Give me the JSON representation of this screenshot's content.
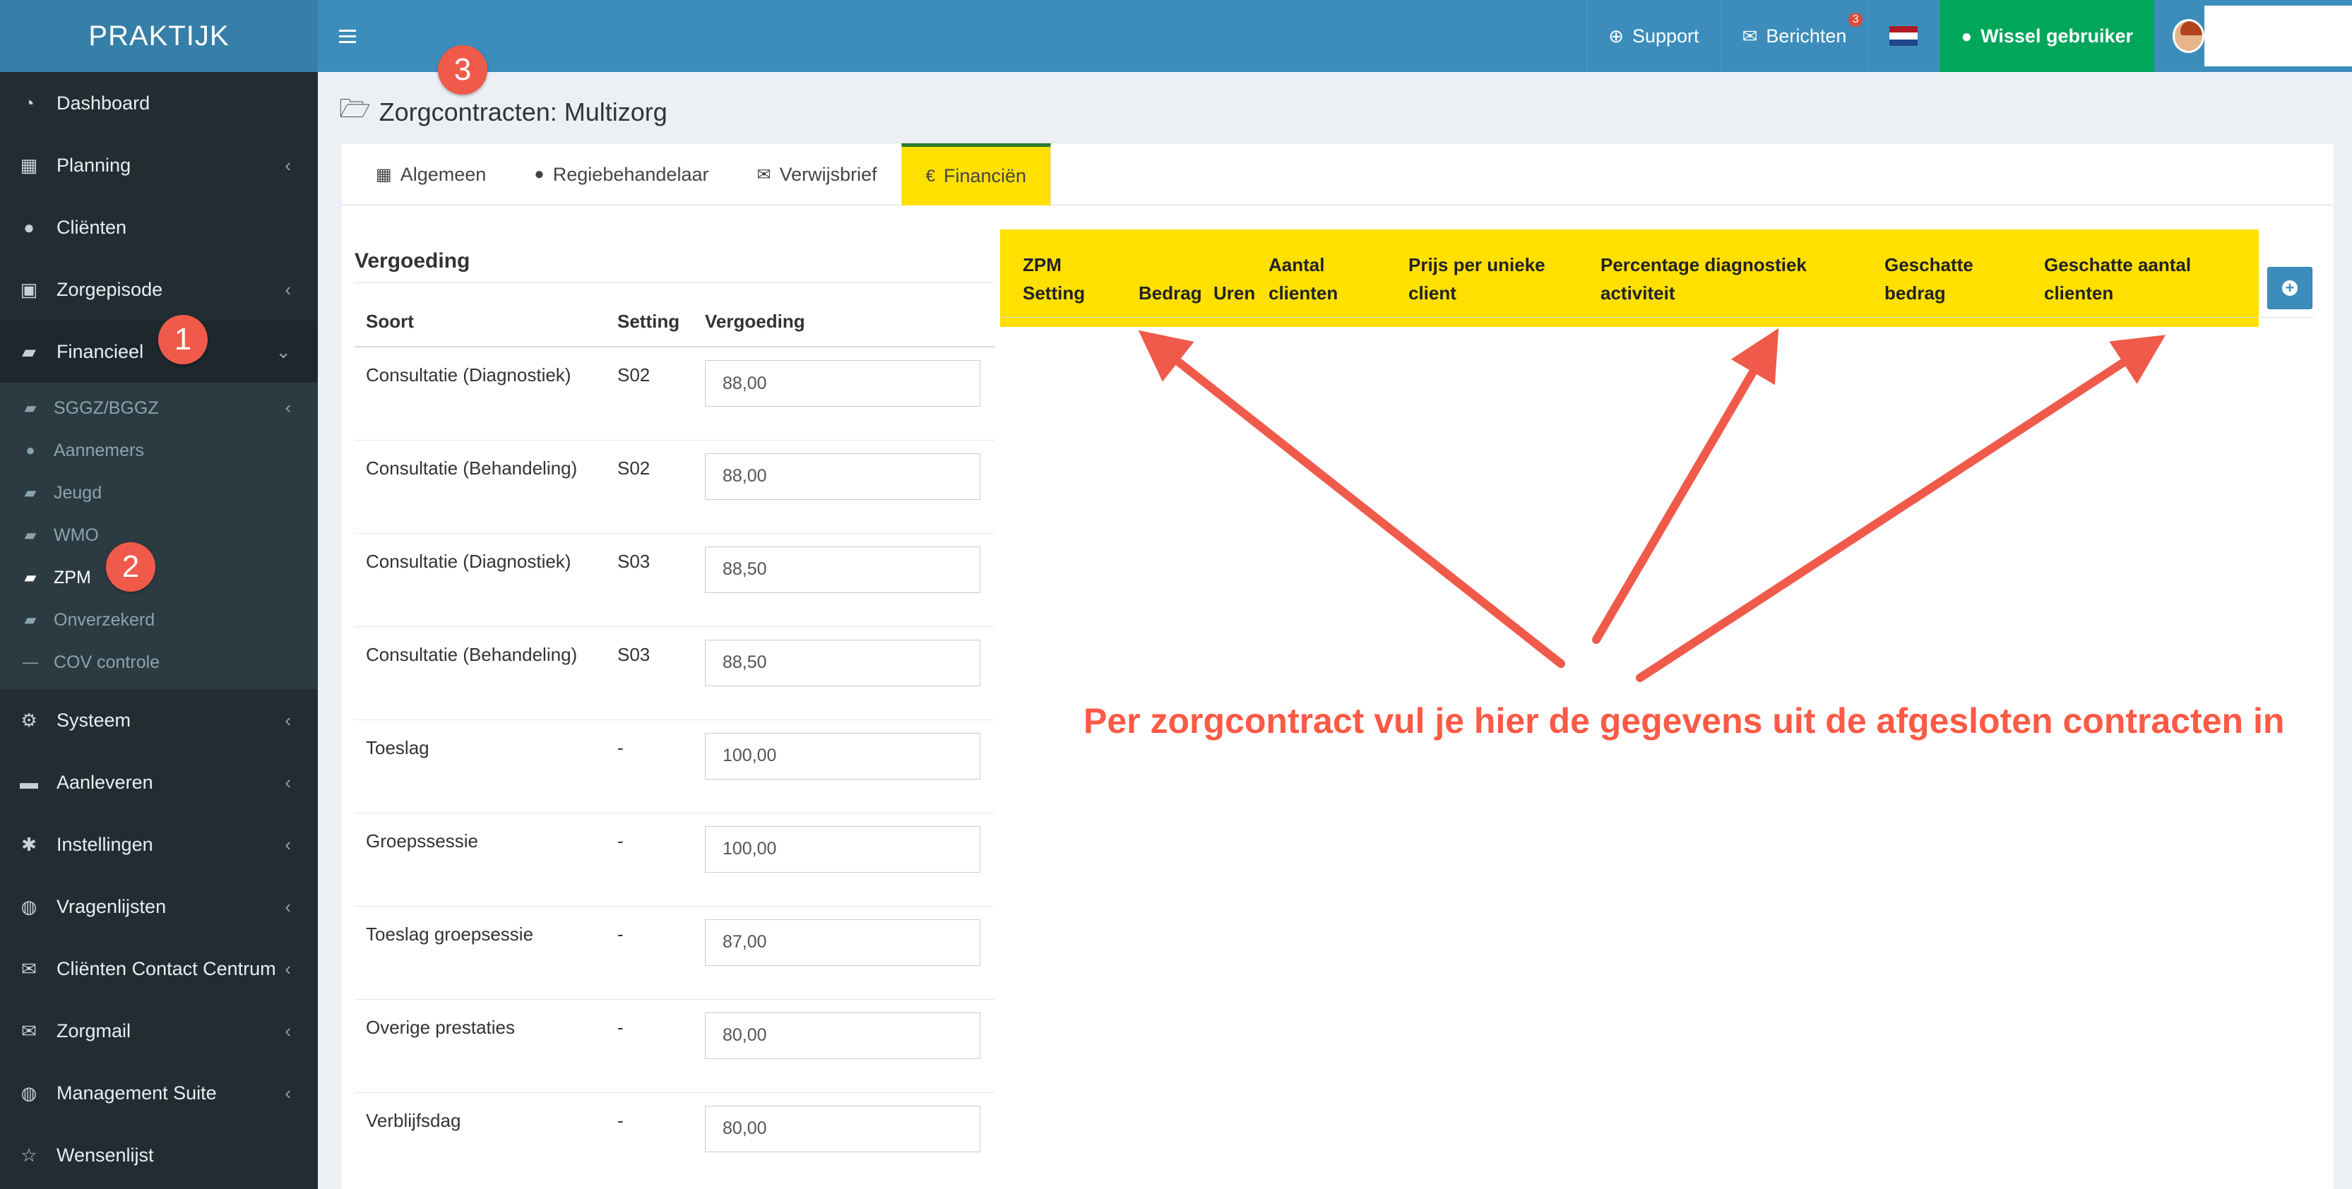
{
  "app": {
    "brand": "PRAKTIJK"
  },
  "sidebar": {
    "items": [
      {
        "label": "Dashboard",
        "icon": "dashboard-icon",
        "chevron": false
      },
      {
        "label": "Planning",
        "icon": "calendar-icon",
        "chevron": true
      },
      {
        "label": "Cliënten",
        "icon": "user-icon",
        "chevron": false
      },
      {
        "label": "Zorgepisode",
        "icon": "briefcase-icon",
        "chevron": true
      },
      {
        "label": "Financieel",
        "icon": "book-icon",
        "chevron": true,
        "expanded": true
      }
    ],
    "sub_items": [
      {
        "label": "SGGZ/BGGZ",
        "icon": "book-icon",
        "chevron": true
      },
      {
        "label": "Aannemers",
        "icon": "users-icon"
      },
      {
        "label": "Jeugd",
        "icon": "book-icon"
      },
      {
        "label": "WMO",
        "icon": "book-icon"
      },
      {
        "label": "ZPM",
        "icon": "book-icon",
        "active": true
      },
      {
        "label": "Onverzekerd",
        "icon": "book-icon"
      },
      {
        "label": "COV controle",
        "icon": "minus-icon"
      }
    ],
    "items_after": [
      {
        "label": "Systeem",
        "icon": "cogs-icon",
        "chevron": true
      },
      {
        "label": "Aanleveren",
        "icon": "truck-icon",
        "chevron": true
      },
      {
        "label": "Instellingen",
        "icon": "gear-icon",
        "chevron": true
      },
      {
        "label": "Vragenlijsten",
        "icon": "globe-icon",
        "chevron": true
      },
      {
        "label": "Cliënten Contact Centrum",
        "icon": "envelope-icon",
        "chevron": true
      },
      {
        "label": "Zorgmail",
        "icon": "envelope-icon",
        "chevron": true
      },
      {
        "label": "Management Suite",
        "icon": "globe-icon",
        "chevron": true
      },
      {
        "label": "Wensenlijst",
        "icon": "star-icon",
        "chevron": false
      }
    ]
  },
  "navbar": {
    "support": "Support",
    "berichten": "Berichten",
    "berichten_count": "3",
    "wissel": "Wissel gebruiker"
  },
  "page": {
    "title": "Zorgcontracten: Multizorg"
  },
  "tabs": [
    {
      "label": "Algemeen",
      "icon": "table-icon"
    },
    {
      "label": "Regiebehandelaar",
      "icon": "user-icon"
    },
    {
      "label": "Verwijsbrief",
      "icon": "envelope-icon"
    },
    {
      "label": "Financiën",
      "icon": "euro-icon",
      "active": true
    }
  ],
  "vergoeding": {
    "title": "Vergoeding",
    "headers": [
      "Soort",
      "Setting",
      "Vergoeding"
    ],
    "rows": [
      {
        "soort": "Consultatie (Diagnostiek)",
        "setting": "S02",
        "vergoeding": "88,00"
      },
      {
        "soort": "Consultatie (Behandeling)",
        "setting": "S02",
        "vergoeding": "88,00"
      },
      {
        "soort": "Consultatie (Diagnostiek)",
        "setting": "S03",
        "vergoeding": "88,50"
      },
      {
        "soort": "Consultatie (Behandeling)",
        "setting": "S03",
        "vergoeding": "88,50"
      },
      {
        "soort": "Toeslag",
        "setting": "-",
        "vergoeding": "100,00"
      },
      {
        "soort": "Groepssessie",
        "setting": "-",
        "vergoeding": "100,00"
      },
      {
        "soort": "Toeslag groepsessie",
        "setting": "-",
        "vergoeding": "87,00"
      },
      {
        "soort": "Overige prestaties",
        "setting": "-",
        "vergoeding": "80,00"
      },
      {
        "soort": "Verblijfsdag",
        "setting": "-",
        "vergoeding": "80,00"
      }
    ]
  },
  "zpm_table": {
    "headers": [
      {
        "line1": "ZPM",
        "line2": "Setting"
      },
      {
        "line1": "",
        "line2": "Bedrag"
      },
      {
        "line1": "",
        "line2": "Uren"
      },
      {
        "line1": "Aantal",
        "line2": "clienten"
      },
      {
        "line1": "Prijs per unieke",
        "line2": "client"
      },
      {
        "line1": "Percentage diagnostiek",
        "line2": "activiteit"
      },
      {
        "line1": "Geschatte",
        "line2": "bedrag"
      },
      {
        "line1": "Geschatte aantal",
        "line2": "clienten"
      }
    ]
  },
  "annotations": {
    "markers": [
      "1",
      "2",
      "3"
    ],
    "callout": "Per zorgcontract vul je hier de gegevens uit de afgesloten contracten in",
    "color": "#f05a4a"
  }
}
